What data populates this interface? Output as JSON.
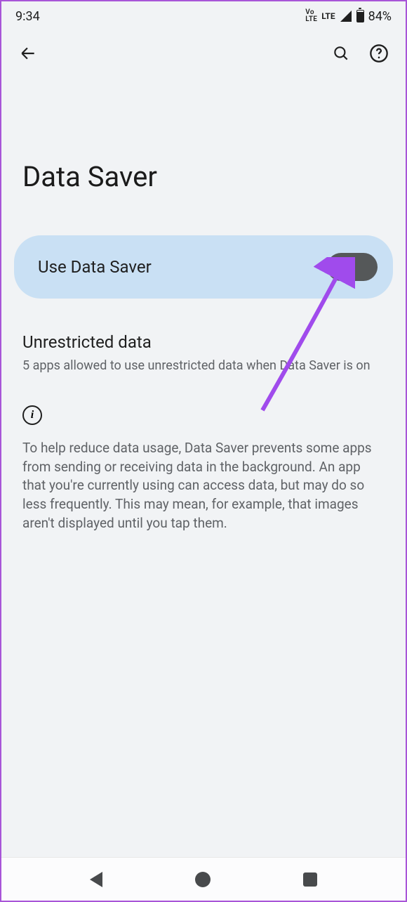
{
  "status_bar": {
    "time": "9:34",
    "volte_label": "Vo\nLTE",
    "network_label": "LTE",
    "battery_percent": "84%"
  },
  "app_bar": {
    "back_name": "back",
    "search_name": "search",
    "help_name": "help"
  },
  "page": {
    "title": "Data Saver"
  },
  "toggle": {
    "label": "Use Data Saver",
    "on": false
  },
  "section_unrestricted": {
    "title": "Unrestricted data",
    "subtitle": "5 apps allowed to use unrestricted data when Data Saver is on"
  },
  "info": {
    "text": "To help reduce data usage, Data Saver prevents some apps from sending or receiving data in the background. An app that you're currently using can access data, but may do so less frequently. This may mean, for example, that images aren't displayed until you tap them."
  }
}
